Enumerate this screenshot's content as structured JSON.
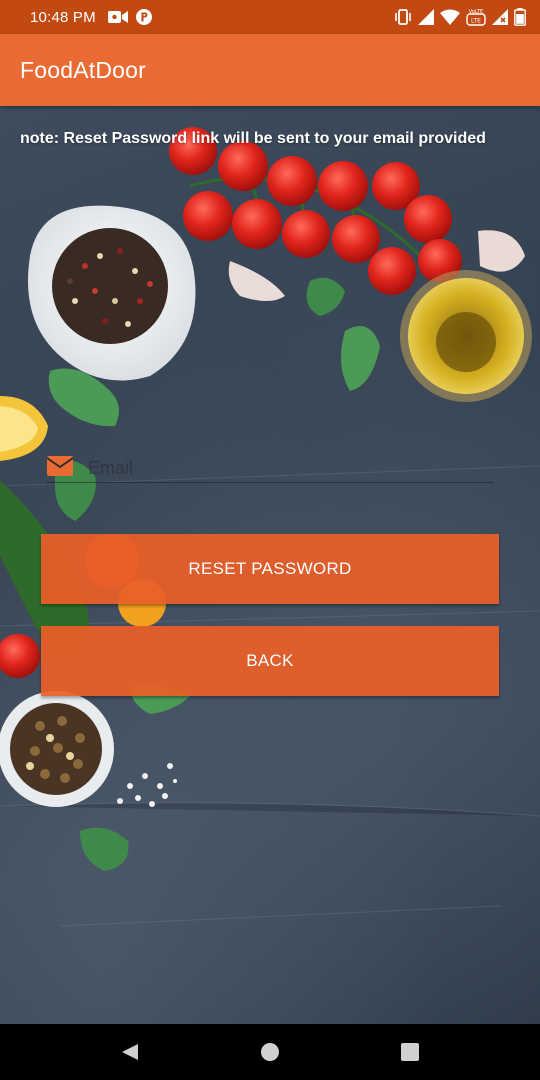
{
  "status_bar": {
    "time": "10:48 PM",
    "left_icons": [
      "video-camera-icon",
      "p-app-icon"
    ],
    "right_icons": [
      "vibrate-icon",
      "signal-icon",
      "wifi-icon",
      "volte-icon",
      "signal-x-icon",
      "battery-icon"
    ],
    "volte_text": "VoLTE"
  },
  "app_bar": {
    "title": "FoodAtDoor",
    "color": "#ea6a33"
  },
  "main": {
    "note": "note: Reset Password link will be sent to your email provided",
    "email": {
      "icon": "email-icon",
      "placeholder": "Email",
      "value": ""
    },
    "reset_button_label": "RESET PASSWORD",
    "back_button_label": "BACK",
    "button_color": "#ea5f28"
  },
  "nav_bar": {
    "buttons": [
      "back-triangle-icon",
      "home-circle-icon",
      "recents-square-icon"
    ]
  }
}
